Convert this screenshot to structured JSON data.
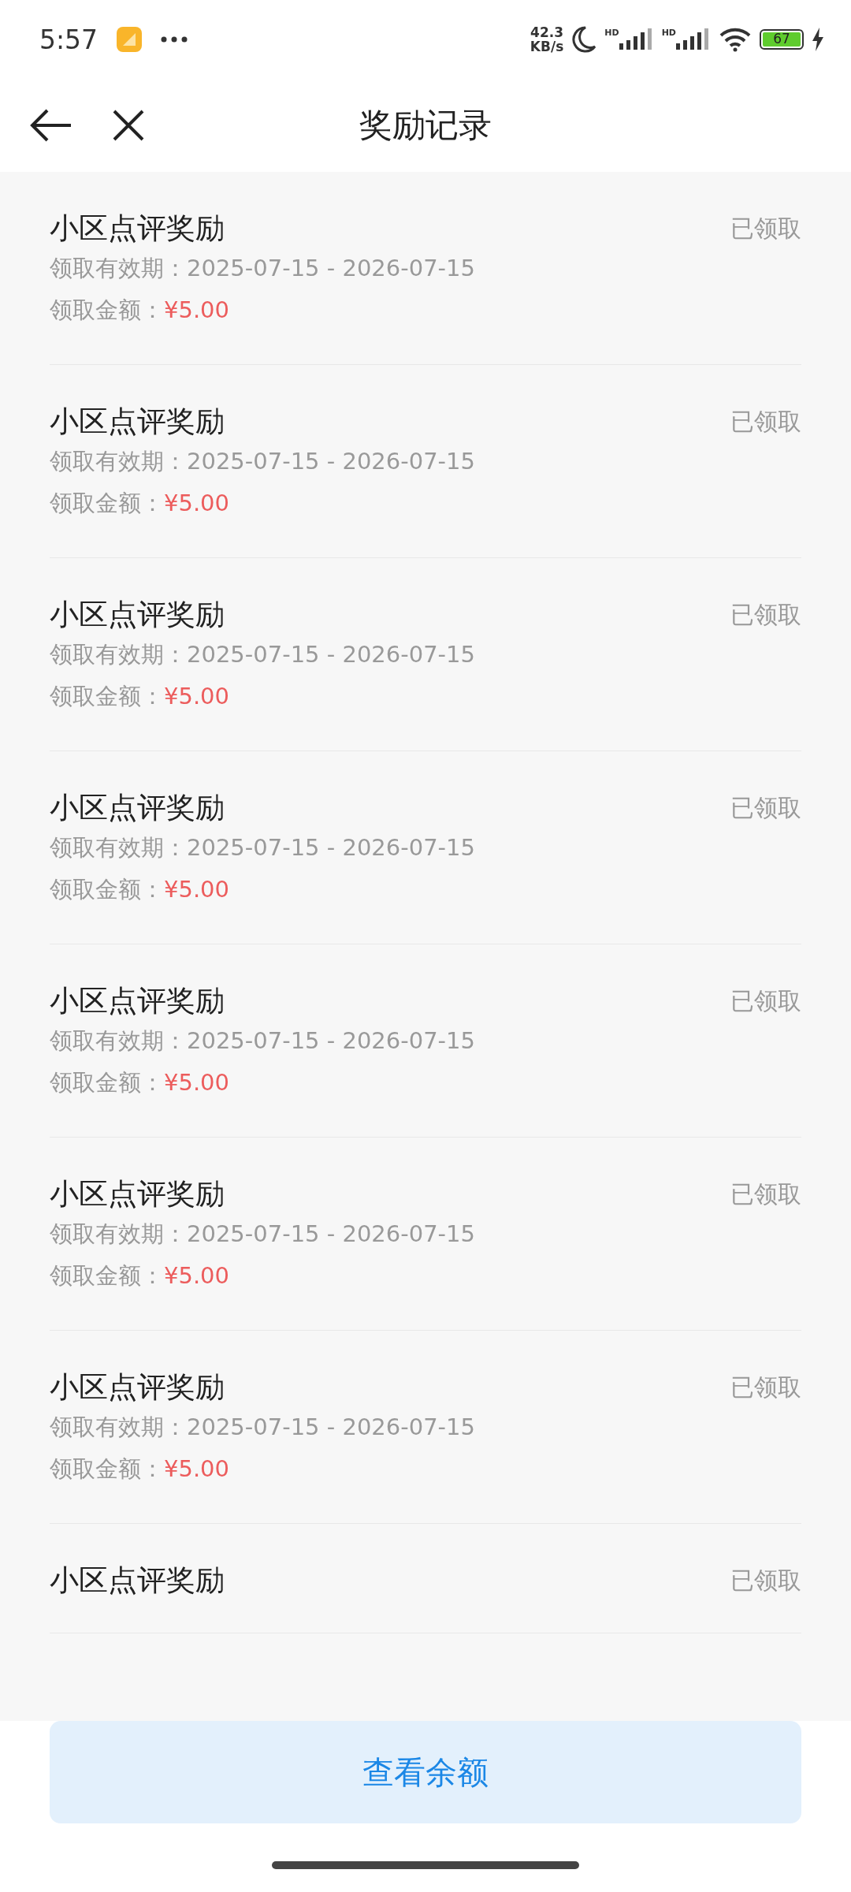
{
  "status_bar": {
    "time": "5:57",
    "speed_value": "42.3",
    "speed_unit": "KB/s",
    "signal_labels": [
      "HD",
      "HD"
    ],
    "battery": "67"
  },
  "header": {
    "title": "奖励记录"
  },
  "rewards": [
    {
      "title": "小区点评奖励",
      "status": "已领取",
      "validity_label": "领取有效期：",
      "validity": "2025-07-15 - 2026-07-15",
      "amount_label": "领取金额：",
      "amount": "¥5.00"
    },
    {
      "title": "小区点评奖励",
      "status": "已领取",
      "validity_label": "领取有效期：",
      "validity": "2025-07-15 - 2026-07-15",
      "amount_label": "领取金额：",
      "amount": "¥5.00"
    },
    {
      "title": "小区点评奖励",
      "status": "已领取",
      "validity_label": "领取有效期：",
      "validity": "2025-07-15 - 2026-07-15",
      "amount_label": "领取金额：",
      "amount": "¥5.00"
    },
    {
      "title": "小区点评奖励",
      "status": "已领取",
      "validity_label": "领取有效期：",
      "validity": "2025-07-15 - 2026-07-15",
      "amount_label": "领取金额：",
      "amount": "¥5.00"
    },
    {
      "title": "小区点评奖励",
      "status": "已领取",
      "validity_label": "领取有效期：",
      "validity": "2025-07-15 - 2026-07-15",
      "amount_label": "领取金额：",
      "amount": "¥5.00"
    },
    {
      "title": "小区点评奖励",
      "status": "已领取",
      "validity_label": "领取有效期：",
      "validity": "2025-07-15 - 2026-07-15",
      "amount_label": "领取金额：",
      "amount": "¥5.00"
    },
    {
      "title": "小区点评奖励",
      "status": "已领取",
      "validity_label": "领取有效期：",
      "validity": "2025-07-15 - 2026-07-15",
      "amount_label": "领取金额：",
      "amount": "¥5.00"
    },
    {
      "title": "小区点评奖励",
      "status": "已领取"
    }
  ],
  "bottom_button": {
    "label": "查看余额"
  }
}
